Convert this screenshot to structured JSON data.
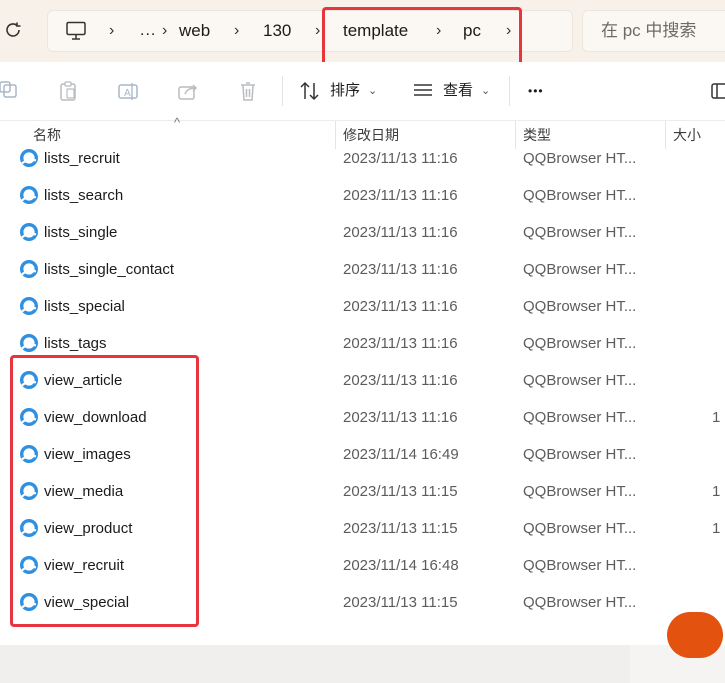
{
  "address_bar": {
    "crumbs": [
      "...",
      "web",
      "130",
      "template",
      "pc"
    ]
  },
  "search": {
    "placeholder": "在 pc 中搜索"
  },
  "toolbar": {
    "sort_label": "排序",
    "view_label": "查看",
    "more_label": "•••"
  },
  "columns": {
    "name": "名称",
    "modified": "修改日期",
    "type": "类型",
    "size": "大小"
  },
  "files": [
    {
      "name": "lists_recruit",
      "modified": "2023/11/13 11:16",
      "type": "QQBrowser HT...",
      "size": ""
    },
    {
      "name": "lists_search",
      "modified": "2023/11/13 11:16",
      "type": "QQBrowser HT...",
      "size": ""
    },
    {
      "name": "lists_single",
      "modified": "2023/11/13 11:16",
      "type": "QQBrowser HT...",
      "size": ""
    },
    {
      "name": "lists_single_contact",
      "modified": "2023/11/13 11:16",
      "type": "QQBrowser HT...",
      "size": ""
    },
    {
      "name": "lists_special",
      "modified": "2023/11/13 11:16",
      "type": "QQBrowser HT...",
      "size": ""
    },
    {
      "name": "lists_tags",
      "modified": "2023/11/13 11:16",
      "type": "QQBrowser HT...",
      "size": ""
    },
    {
      "name": "view_article",
      "modified": "2023/11/13 11:16",
      "type": "QQBrowser HT...",
      "size": ""
    },
    {
      "name": "view_download",
      "modified": "2023/11/13 11:16",
      "type": "QQBrowser HT...",
      "size": "1"
    },
    {
      "name": "view_images",
      "modified": "2023/11/14 16:49",
      "type": "QQBrowser HT...",
      "size": ""
    },
    {
      "name": "view_media",
      "modified": "2023/11/13 11:15",
      "type": "QQBrowser HT...",
      "size": "1"
    },
    {
      "name": "view_product",
      "modified": "2023/11/13 11:15",
      "type": "QQBrowser HT...",
      "size": "1"
    },
    {
      "name": "view_recruit",
      "modified": "2023/11/14 16:48",
      "type": "QQBrowser HT...",
      "size": ""
    },
    {
      "name": "view_special",
      "modified": "2023/11/13 11:15",
      "type": "QQBrowser HT...",
      "size": ""
    }
  ],
  "colors": {
    "highlight": "#e8343c",
    "addr_bg": "#f7f1ea",
    "file_icon_blue": "#2f8fe0",
    "orange_badge": "#e3520f"
  }
}
